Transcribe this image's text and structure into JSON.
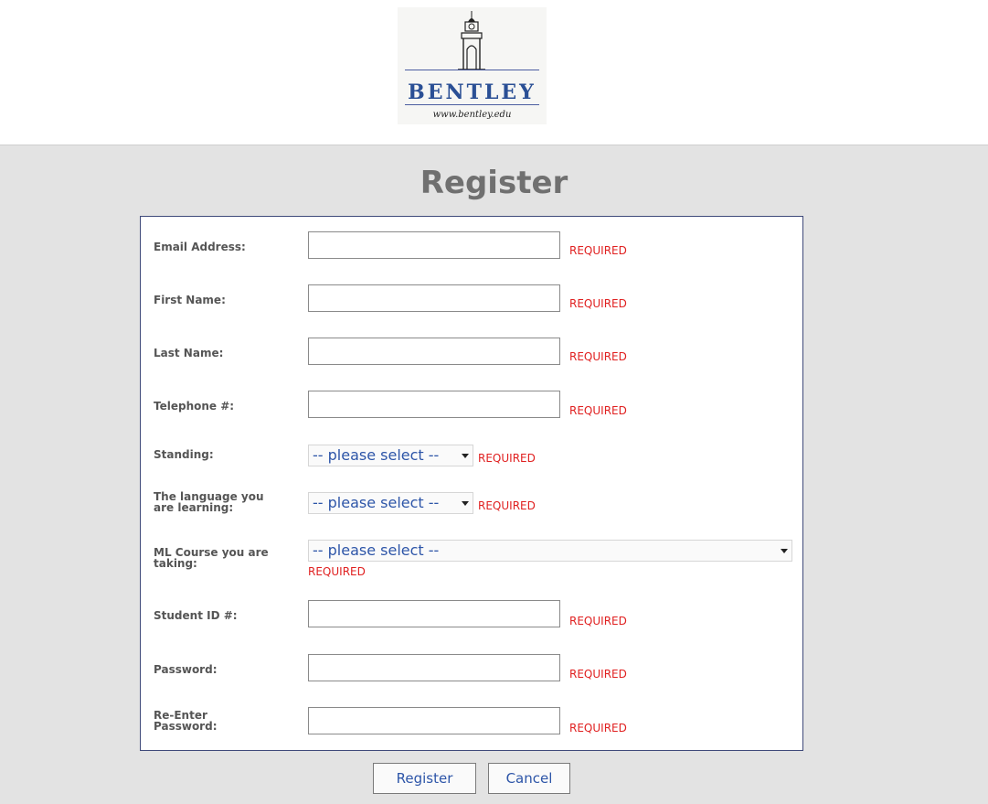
{
  "logo": {
    "name": "BENTLEY",
    "url": "www.bentley.edu"
  },
  "page": {
    "title": "Register"
  },
  "fields": {
    "email": {
      "label": "Email Address:",
      "value": "",
      "required": "REQUIRED"
    },
    "first_name": {
      "label": "First Name:",
      "value": "",
      "required": "REQUIRED"
    },
    "last_name": {
      "label": "Last Name:",
      "value": "",
      "required": "REQUIRED"
    },
    "telephone": {
      "label": "Telephone #:",
      "value": "",
      "required": "REQUIRED"
    },
    "standing": {
      "label": "Standing:",
      "selected": "-- please select --",
      "required": "REQUIRED"
    },
    "language": {
      "label_line1": "The language you",
      "label_line2": "are learning:",
      "selected": "-- please select --",
      "required": "REQUIRED"
    },
    "ml_course": {
      "label_line1": "ML Course you are",
      "label_line2": "taking:",
      "selected": "-- please select --",
      "required": "REQUIRED"
    },
    "student_id": {
      "label": "Student ID #:",
      "value": "",
      "required": "REQUIRED"
    },
    "password": {
      "label": "Password:",
      "value": "",
      "required": "REQUIRED"
    },
    "password_confirm": {
      "label_line1": "Re-Enter",
      "label_line2": "Password:",
      "value": "",
      "required": "REQUIRED"
    }
  },
  "buttons": {
    "register": "Register",
    "cancel": "Cancel"
  },
  "colors": {
    "required": "#e02020",
    "link_blue": "#2d55a8",
    "background": "#e3e3e3",
    "logo_blue": "#2a4f95"
  }
}
